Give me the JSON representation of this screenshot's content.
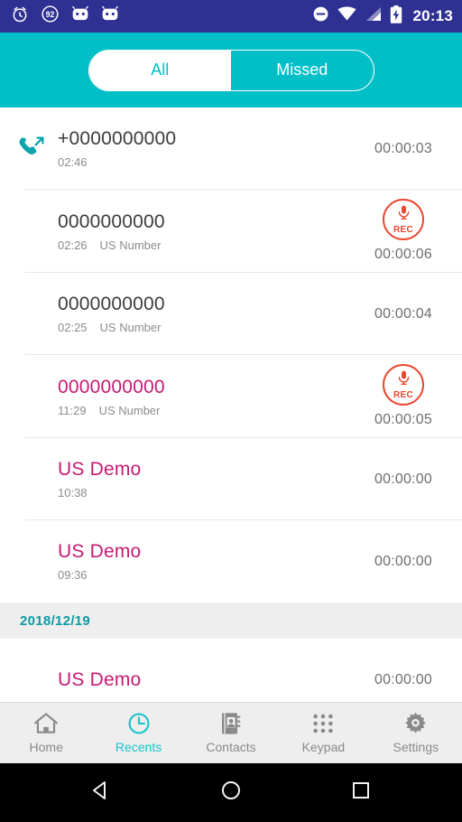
{
  "status_bar": {
    "background_color": "#2f3192",
    "clock": "20:13",
    "left_icons": [
      {
        "name": "alarm-clock-icon"
      },
      {
        "name": "battery-saver-92-icon",
        "label": "92"
      },
      {
        "name": "android-head-icon-1"
      },
      {
        "name": "android-head-icon-2"
      }
    ],
    "right_icons": [
      {
        "name": "do-not-disturb-icon"
      },
      {
        "name": "wifi-icon"
      },
      {
        "name": "cellular-signal-icon"
      },
      {
        "name": "battery-charging-icon"
      }
    ]
  },
  "header": {
    "background_color": "#00bfc7",
    "tabs": [
      {
        "label": "All",
        "active": true
      },
      {
        "label": "Missed",
        "active": false
      }
    ]
  },
  "colors": {
    "teal": "#00bfc7",
    "teal_active": "#17c4cd",
    "magenta": "#c51a73",
    "rec_red": "#e8472f",
    "indigo": "#2f3192",
    "text_primary": "#3c3c3c",
    "text_secondary": "#8c8c8c"
  },
  "call_list": [
    {
      "type": "call",
      "name": "+0000000000",
      "time": "02:46",
      "label": "",
      "duration": "00:00:03",
      "missed": false,
      "icon": "outgoing-call-icon",
      "recording": false
    },
    {
      "type": "call",
      "name": "0000000000",
      "time": "02:26",
      "label": "US Number",
      "duration": "00:00:06",
      "missed": false,
      "icon": "",
      "recording": true
    },
    {
      "type": "call",
      "name": "0000000000",
      "time": "02:25",
      "label": "US Number",
      "duration": "00:00:04",
      "missed": false,
      "icon": "",
      "recording": false
    },
    {
      "type": "call",
      "name": "0000000000",
      "time": "11:29",
      "label": "US Number",
      "duration": "00:00:05",
      "missed": true,
      "icon": "",
      "recording": true
    },
    {
      "type": "call",
      "name": "US Demo",
      "time": "10:38",
      "label": "",
      "duration": "00:00:00",
      "missed": true,
      "icon": "",
      "recording": false
    },
    {
      "type": "call",
      "name": "US Demo",
      "time": "09:36",
      "label": "",
      "duration": "00:00:00",
      "missed": true,
      "icon": "",
      "recording": false
    },
    {
      "type": "date_header",
      "date": "2018/12/19"
    },
    {
      "type": "call",
      "name": "US Demo",
      "time": "",
      "label": "",
      "duration": "00:00:00",
      "missed": true,
      "icon": "",
      "recording": false
    }
  ],
  "rec_badge": {
    "text": "REC",
    "icon": "microphone-icon"
  },
  "bottom_nav": [
    {
      "label": "Home",
      "icon": "home-icon",
      "active": false
    },
    {
      "label": "Recents",
      "icon": "clock-icon",
      "active": true
    },
    {
      "label": "Contacts",
      "icon": "address-book-icon",
      "active": false
    },
    {
      "label": "Keypad",
      "icon": "dialpad-icon",
      "active": false
    },
    {
      "label": "Settings",
      "icon": "gear-icon",
      "active": false
    }
  ],
  "android_nav": [
    {
      "name": "back-button",
      "icon": "triangle-left-icon"
    },
    {
      "name": "home-button",
      "icon": "circle-icon"
    },
    {
      "name": "recents-button",
      "icon": "square-icon"
    }
  ]
}
